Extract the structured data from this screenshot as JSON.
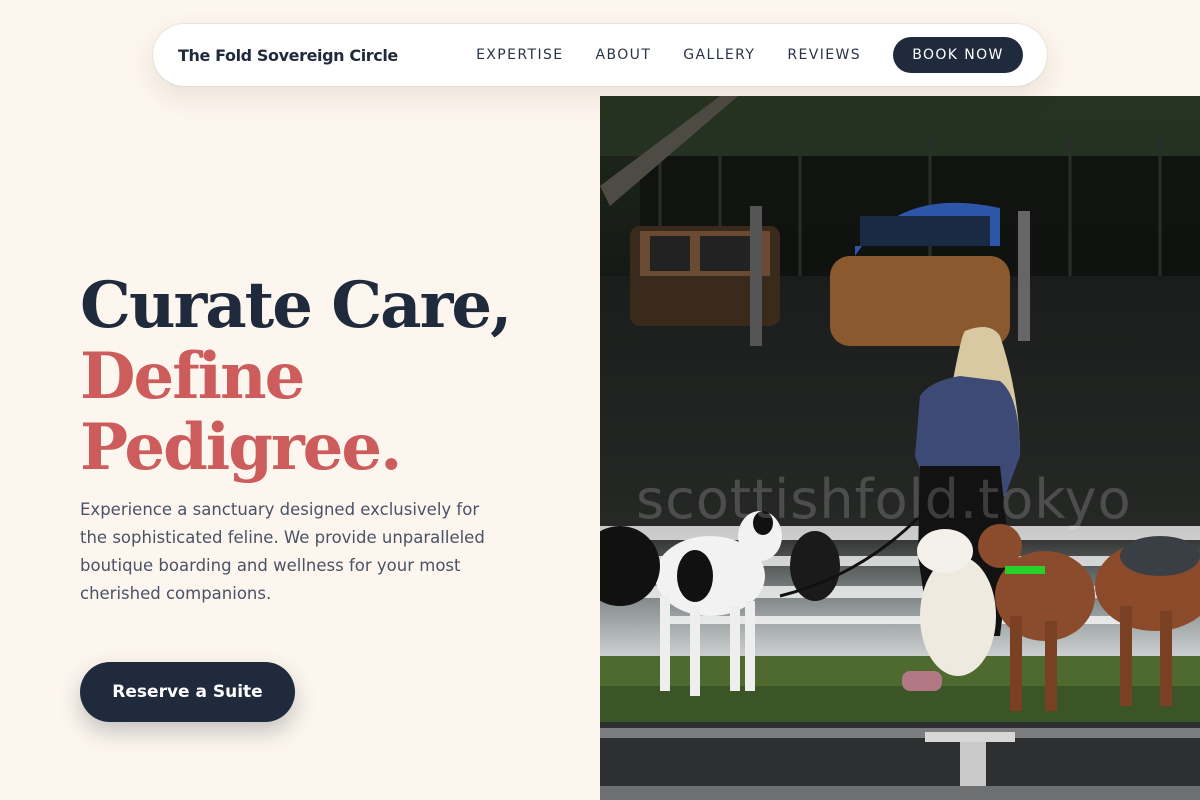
{
  "header": {
    "brand": "The Fold Sovereign Circle",
    "nav": [
      {
        "label": "EXPERTISE"
      },
      {
        "label": "ABOUT"
      },
      {
        "label": "GALLERY"
      },
      {
        "label": "REVIEWS"
      }
    ],
    "book_label": "BOOK NOW"
  },
  "hero": {
    "headline_line1": "Curate Care,",
    "headline_line2": "Define",
    "headline_line3": "Pedigree.",
    "description": "Experience a sanctuary designed exclusively for the sophisticated feline. We provide unparalleled boutique boarding and wellness for your most cherished companions.",
    "cta_label": "Reserve a Suite",
    "image_watermark": "scottishfold.tokyo"
  },
  "colors": {
    "background": "#fdf6ee",
    "navy": "#1f2a3d",
    "accent": "#cd5c5c",
    "body_text": "#4a5266"
  }
}
